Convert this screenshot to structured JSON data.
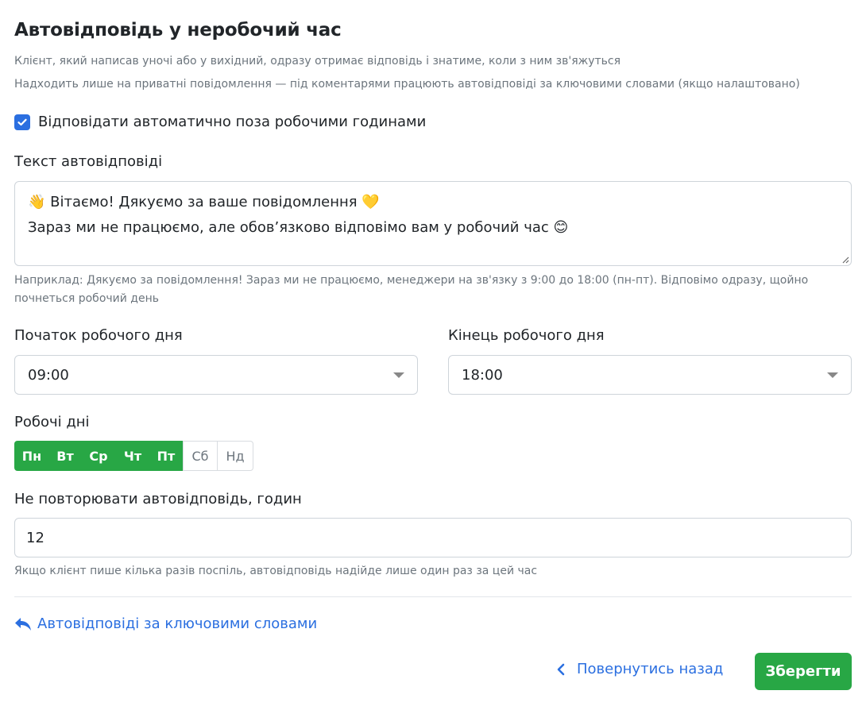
{
  "header": {
    "title": "Автовідповідь у неробочий час",
    "description_1": "Клієнт, який написав уночі або у вихідний, одразу отримає відповідь і знатиме, коли з ним зв'яжуться",
    "description_2": "Надходить лише на приватні повідомлення — під коментарями працюють автовідповіді за ключовими словами (якщо налаштовано)"
  },
  "enable_checkbox": {
    "checked": true,
    "label": "Відповідати автоматично поза робочими годинами"
  },
  "reply_text": {
    "label": "Текст автовідповіді",
    "line_1": "👋 Вітаємо! Дякуємо за ваше повідомлення 💛",
    "line_2": "Зараз ми не працюємо, але обов’язково відповімо вам у робочий час 😊",
    "hint_1": "Наприклад: Дякуємо за повідомлення! Зараз ми не працюємо, менеджери на зв'язку з 9:00 до 18:00 (пн-пт). Відповімо одразу, щойно",
    "hint_2": "почнеться робочий день"
  },
  "work_start": {
    "label": "Початок робочого дня",
    "value": "09:00"
  },
  "work_end": {
    "label": "Кінець робочого дня",
    "value": "18:00"
  },
  "work_days": {
    "label": "Робочі дні",
    "days": [
      {
        "label": "Пн",
        "active": true
      },
      {
        "label": "Вт",
        "active": true
      },
      {
        "label": "Ср",
        "active": true
      },
      {
        "label": "Чт",
        "active": true
      },
      {
        "label": "Пт",
        "active": true
      },
      {
        "label": "Сб",
        "active": false
      },
      {
        "label": "Нд",
        "active": false
      }
    ]
  },
  "repeat_hours": {
    "label": "Не повторювати автовідповідь, годин",
    "value": "12",
    "hint": "Якщо клієнт пише кілька разів поспіль, автовідповідь надійде лише один раз за цей час"
  },
  "keyword_link": {
    "label": "Автовідповіді за ключовими словами",
    "icon": "reply-arrow-icon"
  },
  "footer": {
    "back_label": "Повернутись назад",
    "save_label": "Зберегти"
  },
  "colors": {
    "accent_blue": "#2b6fe0",
    "success_green": "#28a745",
    "muted_text": "#6c757d",
    "border": "#ced4da"
  }
}
